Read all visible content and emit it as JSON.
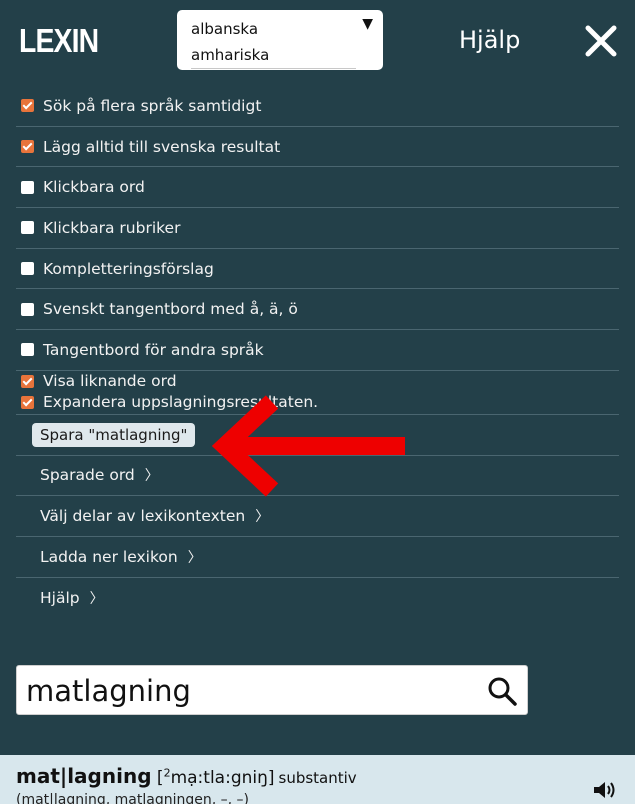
{
  "header": {
    "logo": "LEXIN",
    "languages": [
      "albanska",
      "amhariska"
    ],
    "help_label": "Hjälp"
  },
  "menu": {
    "checkboxes": [
      {
        "label": "Sök på flera språk samtidigt",
        "checked": true
      },
      {
        "label": "Lägg alltid till svenska resultat",
        "checked": true
      },
      {
        "label": "Klickbara ord",
        "checked": false
      },
      {
        "label": "Klickbara rubriker",
        "checked": false
      },
      {
        "label": "Kompletteringsförslag",
        "checked": false
      },
      {
        "label": "Svenskt tangentbord med å, ä, ö",
        "checked": false
      },
      {
        "label": "Tangentbord för andra språk",
        "checked": false
      },
      {
        "label": "Visa liknande ord",
        "checked": true
      },
      {
        "label": "Expandera uppslagningsresultaten.",
        "checked": true
      }
    ],
    "save_label": "Spara \"matlagning\"",
    "links": [
      {
        "label": "Sparade ord",
        "chevron": "〉"
      },
      {
        "label": "Välj delar av lexikontexten",
        "chevron": "〉"
      },
      {
        "label": "Ladda ner lexikon",
        "chevron": "〉"
      },
      {
        "label": "Hjälp",
        "chevron": "〉"
      }
    ]
  },
  "search": {
    "value": "matlagning"
  },
  "result": {
    "word": "mat|lagning",
    "pron_open": " [",
    "pron_sup": "2",
    "pron_text": "mạ:tla:gniŋ]",
    "word_class": "substantiv",
    "inflection": "(mat|lagning, matlagningen, –, –)"
  },
  "colors": {
    "background": "#234049",
    "checkbox_on": "#e8743b",
    "result_bg": "#d8e7ed",
    "annotation_arrow": "#ee0000"
  },
  "icons": [
    "close-icon",
    "search-icon",
    "speaker-icon",
    "dropdown-arrow-icon"
  ]
}
